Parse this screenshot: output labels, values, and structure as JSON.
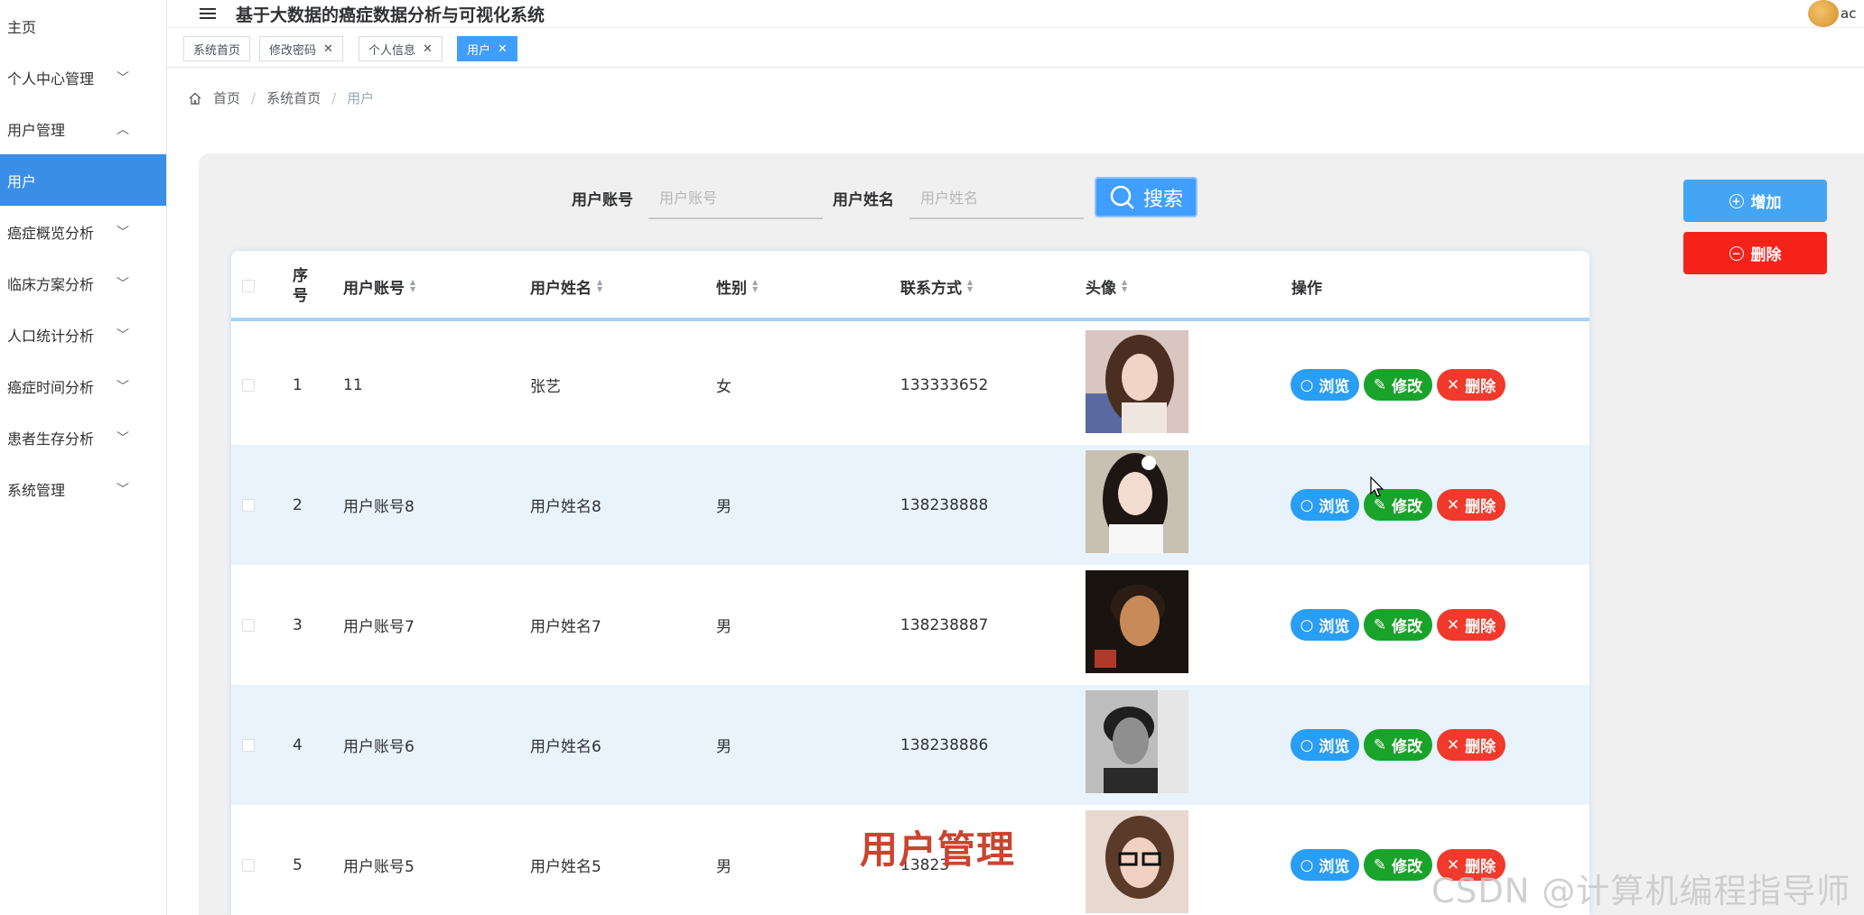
{
  "header": {
    "title": "基于大数据的癌症数据分析与可视化系统",
    "user": "ac"
  },
  "sidebar": {
    "items": [
      {
        "label": "主页",
        "expandable": false,
        "active": false
      },
      {
        "label": "个人中心管理",
        "expandable": true,
        "active": false
      },
      {
        "label": "用户管理",
        "expandable": true,
        "expanded": true,
        "active": false
      },
      {
        "label": "用户",
        "expandable": false,
        "active": true
      },
      {
        "label": "癌症概览分析",
        "expandable": true,
        "active": false
      },
      {
        "label": "临床方案分析",
        "expandable": true,
        "active": false
      },
      {
        "label": "人口统计分析",
        "expandable": true,
        "active": false
      },
      {
        "label": "癌症时间分析",
        "expandable": true,
        "active": false
      },
      {
        "label": "患者生存分析",
        "expandable": true,
        "active": false
      },
      {
        "label": "系统管理",
        "expandable": true,
        "active": false
      }
    ]
  },
  "tabs": [
    {
      "label": "系统首页",
      "closable": false,
      "active": false
    },
    {
      "label": "修改密码",
      "closable": true,
      "active": false
    },
    {
      "label": "个人信息",
      "closable": true,
      "active": false
    },
    {
      "label": "用户",
      "closable": true,
      "active": true
    }
  ],
  "breadcrumb": {
    "home": "首页",
    "mid": "系统首页",
    "current": "用户",
    "sep": "/"
  },
  "search": {
    "account_label": "用户账号",
    "account_placeholder": "用户账号",
    "name_label": "用户姓名",
    "name_placeholder": "用户姓名",
    "button": "搜索"
  },
  "actions": {
    "add": "增加",
    "delete": "删除"
  },
  "table": {
    "headers": {
      "index_line1": "序",
      "index_line2": "号",
      "account": "用户账号",
      "name": "用户姓名",
      "gender": "性别",
      "phone": "联系方式",
      "avatar": "头像",
      "ops": "操作"
    },
    "ops": {
      "view": "浏览",
      "edit": "修改",
      "delete": "删除"
    },
    "rows": [
      {
        "index": "1",
        "account": "11",
        "name": "张艺",
        "gender": "女",
        "phone": "133333652"
      },
      {
        "index": "2",
        "account": "用户账号8",
        "name": "用户姓名8",
        "gender": "男",
        "phone": "138238888"
      },
      {
        "index": "3",
        "account": "用户账号7",
        "name": "用户姓名7",
        "gender": "男",
        "phone": "138238887"
      },
      {
        "index": "4",
        "account": "用户账号6",
        "name": "用户姓名6",
        "gender": "男",
        "phone": "138238886"
      },
      {
        "index": "5",
        "account": "用户账号5",
        "name": "用户姓名5",
        "gender": "男",
        "phone": "13823"
      }
    ]
  },
  "overlay": {
    "title": "用户管理",
    "csdn": "CSDN @计算机编程指导师"
  }
}
